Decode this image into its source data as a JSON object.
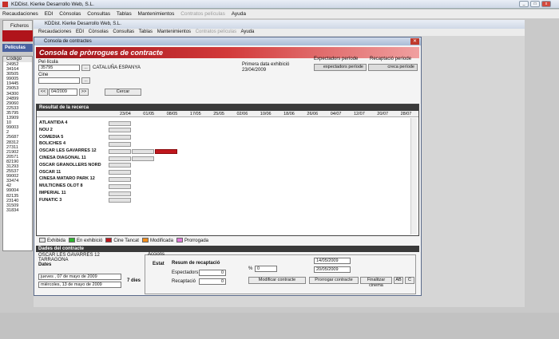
{
  "app": {
    "title": "KDDist. Kierke Desarrollo Web, S.L.",
    "menu": [
      "Recaudaciones",
      "EDI",
      "Cònsolas",
      "Consultas",
      "Tablas",
      "Mantenimientos",
      "Contratos películas",
      "Ayuda"
    ],
    "menu_disabled": [
      false,
      false,
      false,
      false,
      false,
      false,
      true,
      false
    ]
  },
  "sidebar": {
    "tab": "Ficheros",
    "section": "Películas",
    "column": "Código",
    "codes": [
      "24952",
      "34164",
      "30505",
      "99005",
      "19445",
      "29053",
      "34300",
      "24899",
      "29060",
      "22533",
      "35795",
      "13909",
      "10",
      "99003",
      "2",
      "25687",
      "28312",
      "27311",
      "21902",
      "20571",
      "82190",
      "31293",
      "25537",
      "99002",
      "33474",
      "42",
      "99004",
      "82135",
      "23140",
      "31509",
      "31834"
    ]
  },
  "inner": {
    "title": "KDDist. Kierke Desarrollo Web, S.L.",
    "menu": [
      "Recaudaciones",
      "EDI",
      "Cònsolas",
      "Consultas",
      "Tablas",
      "Mantenimientos",
      "Contratos películas",
      "Ayuda"
    ]
  },
  "dialog": {
    "title": "Consola de contractes",
    "banner": "Consola de pròrrogues de contracte",
    "pelicula_label": "Pel·lícula",
    "pelicula_code": "35795",
    "pelicula_distrib": "CATALUÑA ESPANYA",
    "cine_label": "Cine",
    "cine_value": "",
    "primera_label": "Primera data exhibició",
    "primera_value": "23/04/2009",
    "exp_label": "Expectadors període",
    "rec_label": "Recaptació període",
    "exp_value": "expectadors període",
    "rec_value": "creca període",
    "week_prev": "<<",
    "week_value": "04/2009",
    "week_next": ">>",
    "cercar": "Cercar",
    "dots": "..."
  },
  "grid": {
    "header": "Resultat de la recerca",
    "dates": [
      "23/04",
      "01/05",
      "08/05",
      "17/05",
      "25/05",
      "02/06",
      "10/06",
      "18/06",
      "26/06",
      "04/07",
      "12/07",
      "20/07",
      "28/07"
    ],
    "cinemas": [
      "ATLANTIDA 4",
      "NOU 2",
      "COMEDIA 5",
      "BOLICHES 4",
      "OSCAR LES GAVARRES 12",
      "CINESA DIAGONAL 11",
      "OSCAR GRANOLLERS NORD",
      "OSCAR 11",
      "CINESA MATARO PARK 12",
      "MULTICINES OLOT 8",
      "IMPERIAL 11",
      "FUNATIC 3"
    ],
    "red_cell_label": "Cine Tancat"
  },
  "legend": [
    {
      "label": "Exhibida",
      "color": "#e2e2e2"
    },
    {
      "label": "En exhibició",
      "color": "#2db52d"
    },
    {
      "label": "Cine Tancat",
      "color": "#c0171d"
    },
    {
      "label": "Modificada",
      "color": "#f08c1a"
    },
    {
      "label": "Prorrogada",
      "color": "#e07ad8"
    }
  ],
  "bottom": {
    "header": "Dades del contracte",
    "cine": "OSCAR LES GAVARRES 12",
    "localitat": "TARRAGONA",
    "dates_label": "Dates",
    "date1": "jueves , 07 de   mayo   de 2009",
    "date2": "miércoles, 13 de   mayo   de 2009",
    "dies": "7 dies",
    "accions_label": "Accions",
    "estat_label": "Estat",
    "resum_label": "Resum de recaptació",
    "espectadors_label": "Espectadors",
    "espectadors_value": "0",
    "recaptacio_label": "Recaptació",
    "recaptacio_value": "0",
    "percent_label": "%",
    "percent_value": "0",
    "from_date": "14/05/2009",
    "to_date": "20/05/2009",
    "btn_modificar": "Modificar contracte",
    "btn_prorrogar": "Prorrogar contracte",
    "btn_finalitzar": "Finalitzar cinema",
    "btn_ab": "AB",
    "btn_c": "C"
  }
}
